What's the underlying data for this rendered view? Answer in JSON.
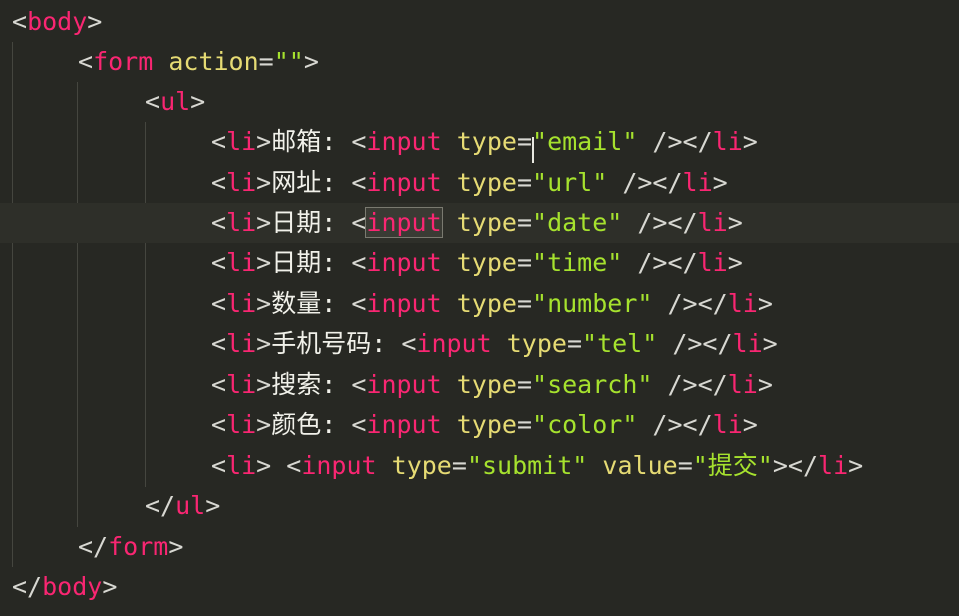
{
  "editor": {
    "lines": [
      {
        "indent": 0,
        "tokens": [
          [
            "punc",
            "<"
          ],
          [
            "tag",
            "body"
          ],
          [
            "punc",
            ">"
          ]
        ]
      },
      {
        "indent": 1,
        "tokens": [
          [
            "punc",
            "<"
          ],
          [
            "tag",
            "form"
          ],
          [
            "punc",
            " "
          ],
          [
            "attr",
            "action"
          ],
          [
            "punc",
            "="
          ],
          [
            "str",
            "\"\""
          ],
          [
            "punc",
            ">"
          ]
        ]
      },
      {
        "indent": 2,
        "tokens": [
          [
            "punc",
            "<"
          ],
          [
            "tag",
            "ul"
          ],
          [
            "punc",
            ">"
          ]
        ]
      },
      {
        "indent": 3,
        "tokens": [
          [
            "punc",
            "<"
          ],
          [
            "tag",
            "li"
          ],
          [
            "punc",
            ">"
          ],
          [
            "text",
            "邮箱: "
          ],
          [
            "punc",
            "<"
          ],
          [
            "tag",
            "input"
          ],
          [
            "punc",
            " "
          ],
          [
            "attr",
            "type"
          ],
          [
            "punc",
            "="
          ],
          [
            "str",
            "\"email\""
          ],
          [
            "punc",
            " /></"
          ],
          [
            "tag",
            "li"
          ],
          [
            "punc",
            ">"
          ]
        ]
      },
      {
        "indent": 3,
        "tokens": [
          [
            "punc",
            "<"
          ],
          [
            "tag",
            "li"
          ],
          [
            "punc",
            ">"
          ],
          [
            "text",
            "网址: "
          ],
          [
            "punc",
            "<"
          ],
          [
            "tag",
            "input"
          ],
          [
            "punc",
            " "
          ],
          [
            "attr",
            "type"
          ],
          [
            "punc",
            "="
          ],
          [
            "str",
            "\"url\""
          ],
          [
            "punc",
            " /></"
          ],
          [
            "tag",
            "li"
          ],
          [
            "punc",
            ">"
          ]
        ]
      },
      {
        "indent": 3,
        "highlight": true,
        "tokens": [
          [
            "punc",
            "<"
          ],
          [
            "tag",
            "li"
          ],
          [
            "punc",
            ">"
          ],
          [
            "text",
            "日期: "
          ],
          [
            "punc",
            "<"
          ],
          [
            "tag sel",
            "input"
          ],
          [
            "punc",
            " "
          ],
          [
            "attr",
            "type"
          ],
          [
            "punc",
            "="
          ],
          [
            "str",
            "\"date\""
          ],
          [
            "punc",
            " /></"
          ],
          [
            "tag",
            "li"
          ],
          [
            "punc",
            ">"
          ]
        ]
      },
      {
        "indent": 3,
        "tokens": [
          [
            "punc",
            "<"
          ],
          [
            "tag",
            "li"
          ],
          [
            "punc",
            ">"
          ],
          [
            "text",
            "日期: "
          ],
          [
            "punc",
            "<"
          ],
          [
            "tag",
            "input"
          ],
          [
            "punc",
            " "
          ],
          [
            "attr",
            "type"
          ],
          [
            "punc",
            "="
          ],
          [
            "str",
            "\"time\""
          ],
          [
            "punc",
            " /></"
          ],
          [
            "tag",
            "li"
          ],
          [
            "punc",
            ">"
          ]
        ]
      },
      {
        "indent": 3,
        "tokens": [
          [
            "punc",
            "<"
          ],
          [
            "tag",
            "li"
          ],
          [
            "punc",
            ">"
          ],
          [
            "text",
            "数量: "
          ],
          [
            "punc",
            "<"
          ],
          [
            "tag",
            "input"
          ],
          [
            "punc",
            " "
          ],
          [
            "attr",
            "type"
          ],
          [
            "punc",
            "="
          ],
          [
            "str",
            "\"number\""
          ],
          [
            "punc",
            " /></"
          ],
          [
            "tag",
            "li"
          ],
          [
            "punc",
            ">"
          ]
        ]
      },
      {
        "indent": 3,
        "tokens": [
          [
            "punc",
            "<"
          ],
          [
            "tag",
            "li"
          ],
          [
            "punc",
            ">"
          ],
          [
            "text",
            "手机号码: "
          ],
          [
            "punc",
            "<"
          ],
          [
            "tag",
            "input"
          ],
          [
            "punc",
            " "
          ],
          [
            "attr",
            "type"
          ],
          [
            "punc",
            "="
          ],
          [
            "str",
            "\"tel\""
          ],
          [
            "punc",
            " /></"
          ],
          [
            "tag",
            "li"
          ],
          [
            "punc",
            ">"
          ]
        ]
      },
      {
        "indent": 3,
        "tokens": [
          [
            "punc",
            "<"
          ],
          [
            "tag",
            "li"
          ],
          [
            "punc",
            ">"
          ],
          [
            "text",
            "搜索: "
          ],
          [
            "punc",
            "<"
          ],
          [
            "tag",
            "input"
          ],
          [
            "punc",
            " "
          ],
          [
            "attr",
            "type"
          ],
          [
            "punc",
            "="
          ],
          [
            "str",
            "\"search\""
          ],
          [
            "punc",
            " /></"
          ],
          [
            "tag",
            "li"
          ],
          [
            "punc",
            ">"
          ]
        ]
      },
      {
        "indent": 3,
        "tokens": [
          [
            "punc",
            "<"
          ],
          [
            "tag",
            "li"
          ],
          [
            "punc",
            ">"
          ],
          [
            "text",
            "颜色: "
          ],
          [
            "punc",
            "<"
          ],
          [
            "tag",
            "input"
          ],
          [
            "punc",
            " "
          ],
          [
            "attr",
            "type"
          ],
          [
            "punc",
            "="
          ],
          [
            "str",
            "\"color\""
          ],
          [
            "punc",
            " /></"
          ],
          [
            "tag",
            "li"
          ],
          [
            "punc",
            ">"
          ]
        ]
      },
      {
        "indent": 3,
        "tokens": [
          [
            "punc",
            "<"
          ],
          [
            "tag",
            "li"
          ],
          [
            "punc",
            "> <"
          ],
          [
            "tag",
            "input"
          ],
          [
            "punc",
            " "
          ],
          [
            "attr",
            "type"
          ],
          [
            "punc",
            "="
          ],
          [
            "str",
            "\"submit\""
          ],
          [
            "punc",
            " "
          ],
          [
            "attr",
            "value"
          ],
          [
            "punc",
            "="
          ],
          [
            "str",
            "\"提交\""
          ],
          [
            "punc",
            "></"
          ],
          [
            "tag",
            "li"
          ],
          [
            "punc",
            ">"
          ]
        ]
      },
      {
        "indent": 2,
        "tokens": [
          [
            "punc",
            "</"
          ],
          [
            "tag",
            "ul"
          ],
          [
            "punc",
            ">"
          ]
        ]
      },
      {
        "indent": 1,
        "tokens": [
          [
            "punc",
            "</"
          ],
          [
            "tag",
            "form"
          ],
          [
            "punc",
            ">"
          ]
        ]
      },
      {
        "indent": 0,
        "tokens": [
          [
            "punc",
            "</"
          ],
          [
            "tag",
            "body"
          ],
          [
            "punc",
            ">"
          ]
        ]
      }
    ]
  }
}
